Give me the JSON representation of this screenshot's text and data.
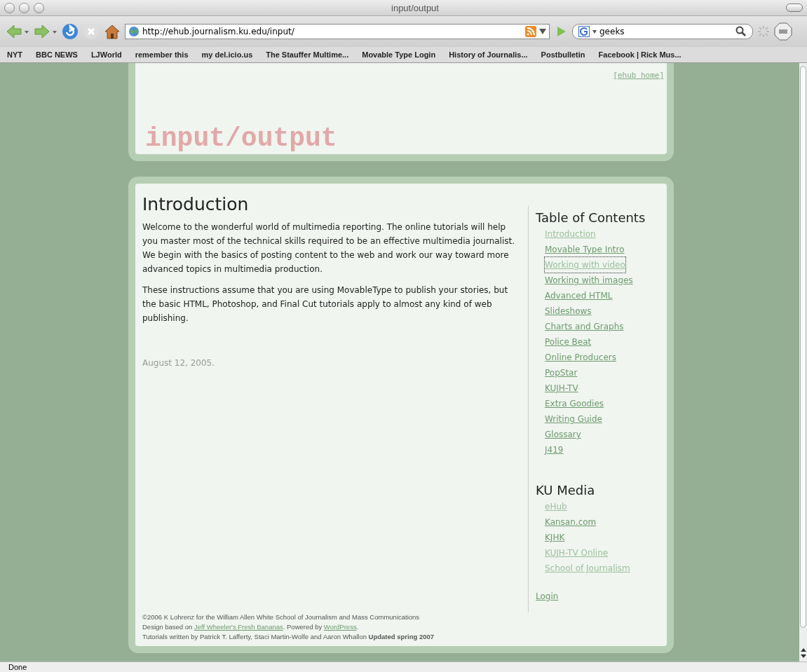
{
  "window": {
    "title": "input/output"
  },
  "toolbar": {
    "url": "http://ehub.journalism.ku.edu/input/",
    "search": "geeks"
  },
  "bookmarks": [
    "NYT",
    "BBC NEWS",
    "LJWorld",
    "remember this",
    "my del.icio.us",
    "The Stauffer Multime...",
    "Movable Type Login",
    "History of Journalis...",
    "Postbulletin",
    "Facebook | Rick Mus..."
  ],
  "header": {
    "home_link": "[ehub home]",
    "site_title": "input/output"
  },
  "article": {
    "heading": "Introduction",
    "paragraphs": [
      "Welcome to the wonderful world of multimedia reporting. The online tutorials will help you master most of the technical skills required to be an effective multimedia journalist. We begin with the basics of posting content to the web and work our way toward more advanced topics in multimedia production.",
      "These instructions assume that you are using MovableType to publish your stories, but the basic HTML, Photoshop, and Final Cut tutorials apply to almost any kind of web publishing."
    ],
    "date": "August 12, 2005."
  },
  "sidebar": {
    "sections": [
      {
        "title": "Table of Contents",
        "links": [
          {
            "label": "Introduction",
            "visited": true,
            "focused": false
          },
          {
            "label": "Movable Type Intro",
            "visited": false,
            "focused": false
          },
          {
            "label": "Working with video",
            "visited": true,
            "focused": true
          },
          {
            "label": "Working with images",
            "visited": false,
            "focused": false
          },
          {
            "label": "Advanced HTML",
            "visited": false,
            "focused": false
          },
          {
            "label": "Slideshows",
            "visited": false,
            "focused": false
          },
          {
            "label": "Charts and Graphs",
            "visited": false,
            "focused": false
          },
          {
            "label": "Police Beat",
            "visited": false,
            "focused": false
          },
          {
            "label": "Online Producers",
            "visited": false,
            "focused": false
          },
          {
            "label": "PopStar",
            "visited": false,
            "focused": false
          },
          {
            "label": "KUJH-TV",
            "visited": false,
            "focused": false
          },
          {
            "label": "Extra Goodies",
            "visited": false,
            "focused": false
          },
          {
            "label": "Writing Guide",
            "visited": false,
            "focused": false
          },
          {
            "label": "Glossary",
            "visited": false,
            "focused": false
          },
          {
            "label": "J419",
            "visited": false,
            "focused": false
          }
        ]
      },
      {
        "title": "KU Media",
        "links": [
          {
            "label": "eHub",
            "visited": true,
            "focused": false
          },
          {
            "label": "Kansan.com",
            "visited": false,
            "focused": false
          },
          {
            "label": "KJHK",
            "visited": false,
            "focused": false
          },
          {
            "label": "KUJH-TV Online",
            "visited": true,
            "focused": false
          },
          {
            "label": "School of Journalism",
            "visited": true,
            "focused": false
          }
        ]
      }
    ],
    "login": "Login"
  },
  "footer": {
    "copyright": "©2006 K Lohrenz for the William Allen White School of Journalism and Mass Communications",
    "design_prefix": "Design based on ",
    "design_link": "Jeff Wheeler's Fresh Bananas",
    "powered_prefix": ". Powered by ",
    "powered_link": "WordPress",
    "powered_suffix": ".",
    "credits": "Tutorials written by Patrick T. Lafferty, Staci Martin-Wolfe and Aaron Whallon **Updated spring 2007**"
  },
  "status_bar": {
    "text": "Done"
  }
}
